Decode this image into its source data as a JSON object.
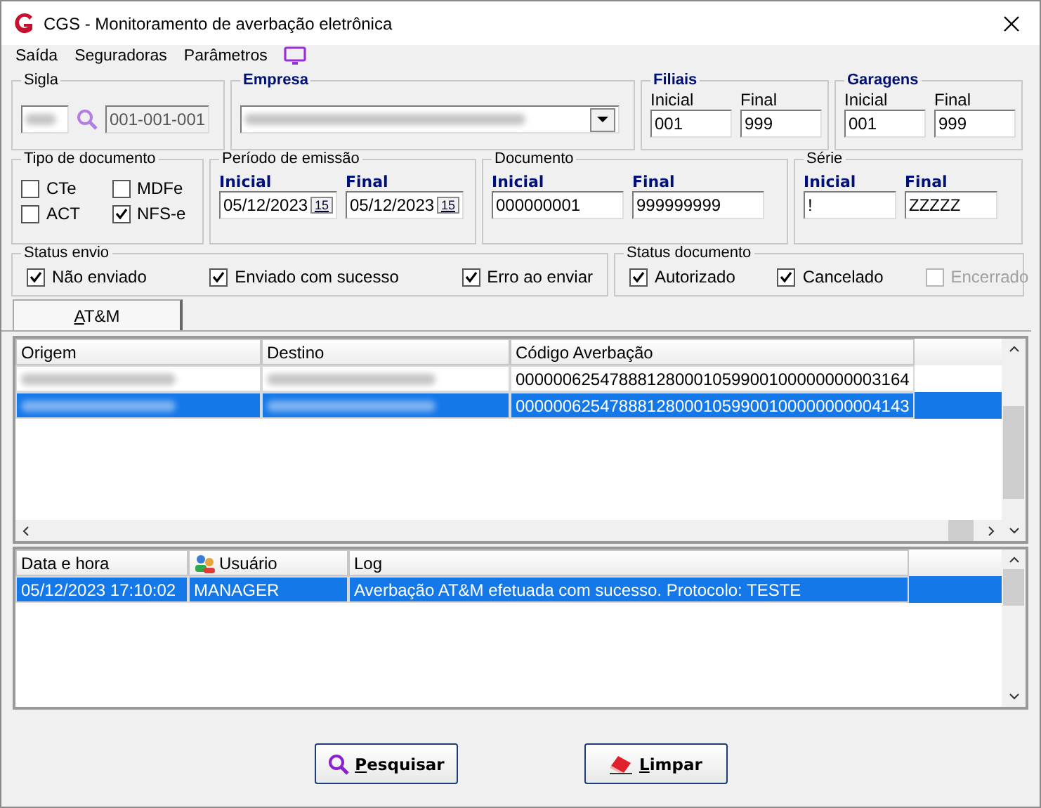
{
  "window": {
    "title": "CGS - Monitoramento de averbação eletrônica"
  },
  "menu": [
    {
      "label": "Saída"
    },
    {
      "label": "Seguradoras"
    },
    {
      "label": "Parâmetros"
    }
  ],
  "sigla": {
    "title": "Sigla",
    "code": "001-001-001"
  },
  "empresa": {
    "title": "Empresa"
  },
  "filiais": {
    "title": "Filiais",
    "fields": [
      {
        "label": "Inicial",
        "value": "001"
      },
      {
        "label": "Final",
        "value": "999"
      }
    ]
  },
  "garagens": {
    "title": "Garagens",
    "fields": [
      {
        "label": "Inicial",
        "value": "001"
      },
      {
        "label": "Final",
        "value": "999"
      }
    ]
  },
  "tipo_documento": {
    "title": "Tipo de documento",
    "options": [
      {
        "label": "CTe",
        "checked": false
      },
      {
        "label": "MDFe",
        "checked": false
      },
      {
        "label": "ACT",
        "checked": false
      },
      {
        "label": "NFS-e",
        "checked": true
      }
    ]
  },
  "periodo": {
    "title": "Período de emissão",
    "fields": [
      {
        "label": "Inicial",
        "value": "05/12/2023",
        "button": "15"
      },
      {
        "label": "Final",
        "value": "05/12/2023",
        "button": "15"
      }
    ]
  },
  "documento": {
    "title": "Documento",
    "fields": [
      {
        "label": "Inicial",
        "value": "000000001"
      },
      {
        "label": "Final",
        "value": "999999999"
      }
    ]
  },
  "serie": {
    "title": "Série",
    "fields": [
      {
        "label": "Inicial",
        "value": "!"
      },
      {
        "label": "Final",
        "value": "ZZZZZ"
      }
    ]
  },
  "status_envio": {
    "title": "Status envio",
    "options": [
      {
        "label": "Não enviado",
        "checked": true,
        "disabled": false
      },
      {
        "label": "Enviado com sucesso",
        "checked": true,
        "disabled": false
      },
      {
        "label": "Erro ao enviar",
        "checked": true,
        "disabled": false
      }
    ]
  },
  "status_documento": {
    "title": "Status documento",
    "options": [
      {
        "label": "Autorizado",
        "checked": true,
        "disabled": false
      },
      {
        "label": "Cancelado",
        "checked": true,
        "disabled": false
      },
      {
        "label": "Encerrado",
        "checked": false,
        "disabled": true
      }
    ]
  },
  "tabs": [
    {
      "label": "AT&M",
      "selected": true
    }
  ],
  "results": {
    "columns": [
      "Origem",
      "Destino",
      "Código Averbação"
    ],
    "rows": [
      {
        "code": "000000625478881280001059900100000000003164",
        "selected": false
      },
      {
        "code": "000000625478881280001059900100000000004143",
        "selected": true
      }
    ]
  },
  "log": {
    "columns": [
      "Data e hora",
      "Usuário",
      "Log"
    ],
    "rows": [
      {
        "datetime": "05/12/2023 17:10:02",
        "user": "MANAGER",
        "message": "Averbação AT&M efetuada com sucesso. Protocolo: TESTE",
        "selected": true
      }
    ]
  },
  "buttons": [
    {
      "label": "Pesquisar",
      "kind": "search"
    },
    {
      "label": "Limpar",
      "kind": "clear"
    }
  ]
}
